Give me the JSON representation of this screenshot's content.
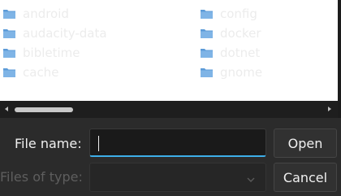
{
  "files": [
    {
      "name": "android",
      "icon": "folder-icon"
    },
    {
      "name": "audacity-data",
      "icon": "folder-icon"
    },
    {
      "name": "bibletime",
      "icon": "folder-icon"
    },
    {
      "name": "cache",
      "icon": "folder-icon"
    },
    {
      "name": "config",
      "icon": "folder-icon"
    },
    {
      "name": "docker",
      "icon": "folder-icon"
    },
    {
      "name": "dotnet",
      "icon": "folder-icon"
    },
    {
      "name": "gnome",
      "icon": "folder-icon"
    }
  ],
  "scrollbar": {
    "position": 0
  },
  "filename": {
    "label": "File name:",
    "value": ""
  },
  "filetype": {
    "label": "Files of type:",
    "selected": ""
  },
  "buttons": {
    "open": "Open",
    "cancel": "Cancel"
  },
  "colors": {
    "accent": "#3daee9",
    "folder": "#5c9bd8"
  }
}
